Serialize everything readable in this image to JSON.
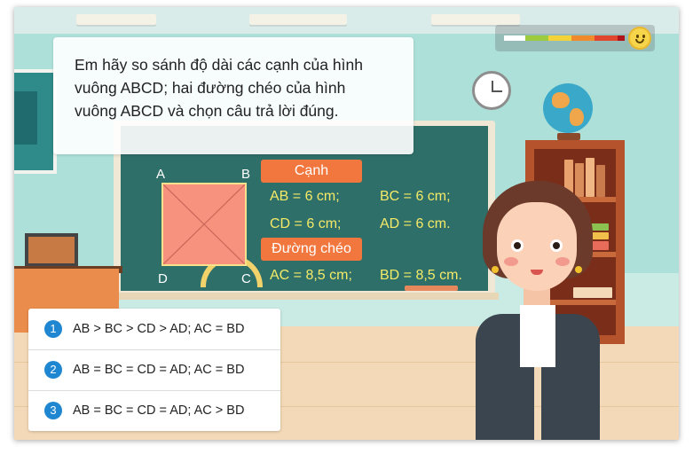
{
  "question": {
    "line1": "Em hãy so sánh độ dài các cạnh của hình",
    "line2": "vuông ABCD; hai đường chéo của hình",
    "line3": "vuông ABCD và chọn câu trả lời đúng."
  },
  "board": {
    "vertices": {
      "a": "A",
      "b": "B",
      "c": "C",
      "d": "D"
    },
    "sides_tag": "Cạnh",
    "sides": [
      "AB = 6 cm;",
      "BC = 6 cm;",
      "CD = 6 cm;",
      "AD = 6 cm."
    ],
    "diagonals_tag": "Đường chéo",
    "diagonals": [
      "AC = 8,5 cm;",
      "BD = 8,5 cm."
    ]
  },
  "options": [
    {
      "number": "1",
      "text": "AB > BC > CD > AD; AC = BD"
    },
    {
      "number": "2",
      "text": "AB = BC = CD = AD; AC = BD"
    },
    {
      "number": "3",
      "text": "AB = BC = CD = AD; AC > BD"
    }
  ],
  "progress": {
    "segment_colors": [
      "#ffffff",
      "#9ccc3d",
      "#f4d23a",
      "#f08a2a",
      "#e2452d",
      "#b1131a"
    ]
  },
  "colors": {
    "chalkboard": "#2f6f6a",
    "tag": "#f1773e",
    "chalk_text": "#f4ea67",
    "option_number": "#1f86d1"
  },
  "icons": [
    "smiley-icon",
    "clock-icon",
    "globe-icon"
  ]
}
